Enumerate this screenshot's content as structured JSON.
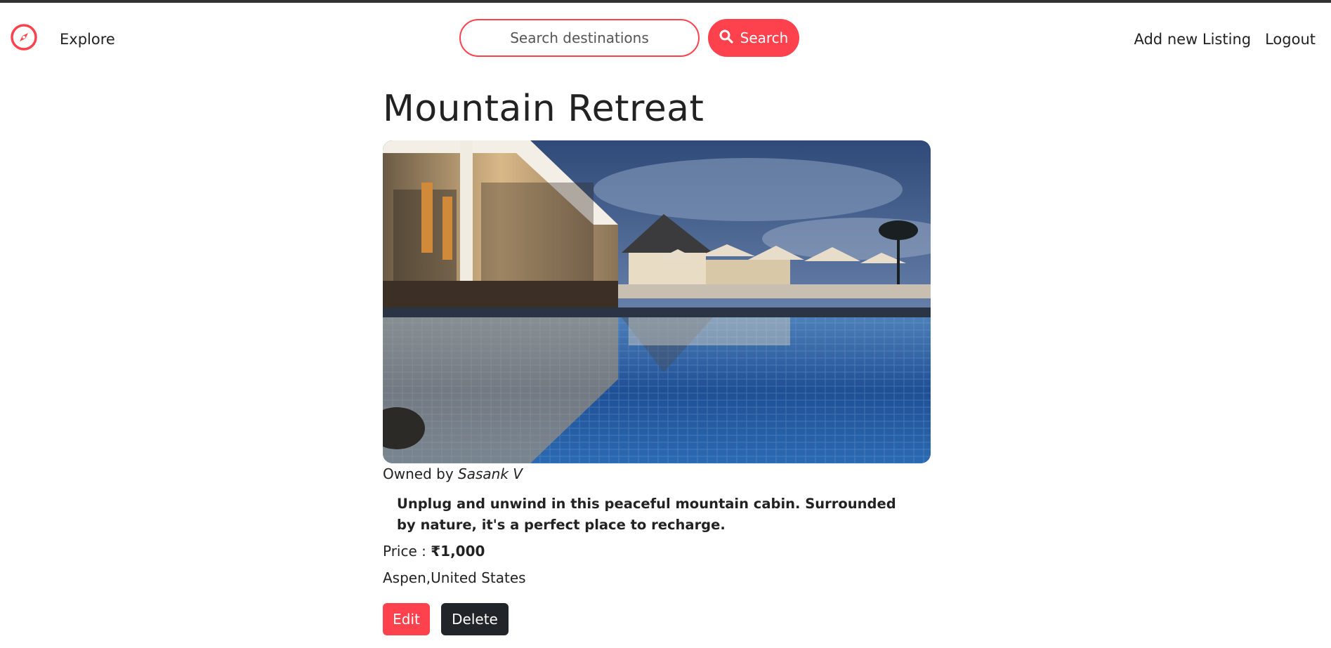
{
  "colors": {
    "accent": "#fe424d",
    "dark_button": "#212529",
    "text": "#222222"
  },
  "navbar": {
    "brand_icon": "compass-icon",
    "explore_label": "Explore",
    "search": {
      "placeholder": "Search destinations",
      "value": "",
      "button_icon": "search-icon",
      "button_label": "Search"
    },
    "add_listing_label": "Add new Listing",
    "logout_label": "Logout"
  },
  "listing": {
    "title": "Mountain Retreat",
    "image_alt": "Resort pool at dusk",
    "owner_prefix": "Owned by",
    "owner_name": "Sasank V",
    "description": "Unplug and unwind in this peaceful mountain cabin. Surrounded by nature, it's a perfect place to recharge.",
    "price_prefix": "Price : ",
    "price_value": "₹1,000",
    "location": "Aspen,United States"
  },
  "actions": {
    "edit_label": "Edit",
    "delete_label": "Delete"
  }
}
